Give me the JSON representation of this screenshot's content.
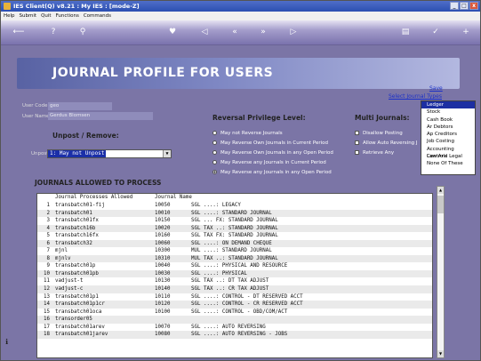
{
  "window": {
    "title": "IES Client(Q) v8.21 : My IES :     [mode-Z]",
    "controls": [
      "_",
      "□",
      "x"
    ]
  },
  "menu": [
    "Help",
    "Submit",
    "Quit",
    "Functions",
    "Commands"
  ],
  "toolbar_icons": [
    "back-arrow-icon",
    "help-icon",
    "search-icon",
    "heart-icon",
    "rewind-icon",
    "previous-icon",
    "next-icon",
    "fast-forward-icon",
    "save-icon",
    "ok-icon",
    "add-icon"
  ],
  "banner": {
    "title": "JOURNAL PROFILE FOR USERS"
  },
  "links": {
    "save": "Save",
    "select_types": "Select Journal Types"
  },
  "user": {
    "code_label": "User Code",
    "code_value": "geo",
    "name_label": "User Name",
    "name_value": "Gerdus Blomsen"
  },
  "unpost": {
    "section": "Unpost / Remove:",
    "label": "Unpost",
    "value": "1: May not Unpost"
  },
  "reversal": {
    "section": "Reversal Privilege Level:",
    "options": [
      {
        "label": "May not Reverse Journals",
        "checked": false
      },
      {
        "label": "May Reverse Own Journals in Current Period",
        "checked": false
      },
      {
        "label": "May Reverse Own Journals in any Open Period",
        "checked": false
      },
      {
        "label": "May Reverse any Journals in Current Period",
        "checked": false
      },
      {
        "label": "May Reverse any Journals in any Open Period",
        "checked": true
      }
    ]
  },
  "multi": {
    "section": "Multi Journals:",
    "options": [
      {
        "label": "Disallow Posting",
        "checked": false
      },
      {
        "label": "Allow Auto Reversing J",
        "checked": false
      },
      {
        "label": "Retrieve Any",
        "checked": false
      }
    ]
  },
  "journal_types": [
    "Ledger",
    "Stock",
    "Cash Book",
    "Ar Debtors",
    "Ap Creditors",
    "Job Costing",
    "Accounting Controls",
    "Law And Legal",
    "None Of These"
  ],
  "journal_types_selected": "Ledger",
  "table": {
    "heading": "JOURNALS ALLOWED TO PROCESS",
    "columns": [
      "Journal Processes Allowed",
      "Journal Name"
    ],
    "rows": [
      [
        "1",
        "transbatch01-fij",
        "10050",
        "SGL ....: LEGACY"
      ],
      [
        "2",
        "transbatch01",
        "10010",
        "SGL ....: STANDARD JOURNAL"
      ],
      [
        "3",
        "transbatch01fx",
        "10150",
        "SGL ... FX: STANDARD JOURNAL"
      ],
      [
        "4",
        "transbatch16b",
        "10020",
        "SGL TAX ..: STANDARD JOURNAL"
      ],
      [
        "5",
        "transbatch16fx",
        "10160",
        "SGL TAX FX: STANDARD JOURNAL"
      ],
      [
        "6",
        "transbatch32",
        "10060",
        "SGL ....: ON DEMAND CHEQUE"
      ],
      [
        "7",
        "mjnl",
        "10300",
        "MUL ....: STANDARD JOURNAL"
      ],
      [
        "8",
        "mjnlv",
        "10310",
        "MUL TAX ..: STANDARD JOURNAL"
      ],
      [
        "9",
        "transbatch01p",
        "10040",
        "SGL ....: PHYSICAL AND RESOURCE"
      ],
      [
        "10",
        "transbatch01pb",
        "10030",
        "SGL ....: PHYSICAL"
      ],
      [
        "11",
        "vadjust-t",
        "10130",
        "SGL TAX ..: DT TAX ADJUST"
      ],
      [
        "12",
        "vadjust-c",
        "10140",
        "SGL TAX ..: CR TAX ADJUST"
      ],
      [
        "13",
        "transbatch01p1",
        "10110",
        "SGL ....: CONTROL - DT RESERVED ACCT"
      ],
      [
        "14",
        "transbatch01p1cr",
        "10120",
        "SGL ....: CONTROL - CR RESERVED ACCT"
      ],
      [
        "15",
        "transbatch01oca",
        "10100",
        "SGL ....: CONTROL - OBD/COM/ACT"
      ],
      [
        "16",
        "transorder05",
        "",
        ""
      ],
      [
        "17",
        "transbatch01arev",
        "10070",
        "SGL ....: AUTO REVERSING"
      ],
      [
        "18",
        "transbatch01jarev",
        "10080",
        "SGL ....: AUTO REVERSING - JOBS"
      ]
    ]
  }
}
